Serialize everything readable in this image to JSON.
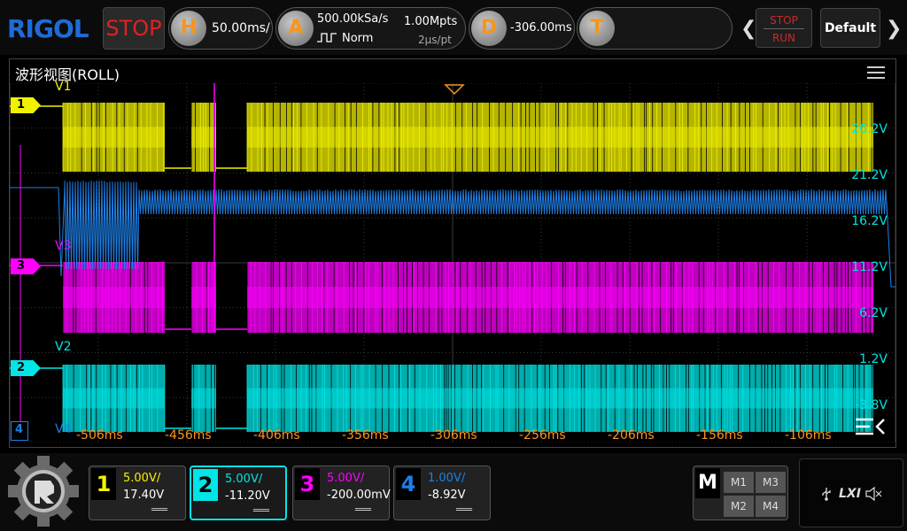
{
  "header": {
    "logo": "RIGOL",
    "stop_label": "STOP",
    "horizontal": {
      "icon": "H",
      "value": "50.00ms/"
    },
    "acquire": {
      "icon": "A",
      "sample_rate": "500.00kSa/s",
      "depth": "1.00Mpts",
      "mode": "Norm",
      "interval": "2μs/pt"
    },
    "delay": {
      "icon": "D",
      "value": "-306.00ms"
    },
    "trigger": {
      "icon": "T"
    },
    "stoprun": {
      "stop": "STOP",
      "run": "RUN"
    },
    "default_label": "Default"
  },
  "window": {
    "title": "波形视图(ROLL)"
  },
  "markers": {
    "ch1_tag": "1",
    "ch2_tag": "2",
    "ch3_tag": "3",
    "ch4_tag": "4",
    "v1": "V1",
    "v2": "V2",
    "v3": "V3",
    "v4": "V4"
  },
  "volt_labels": [
    "26.2V",
    "21.2V",
    "16.2V",
    "11.2V",
    "6.2V",
    "1.2V",
    "-3.8V"
  ],
  "time_labels": [
    "-506ms",
    "-456ms",
    "-406ms",
    "-356ms",
    "-306ms",
    "-256ms",
    "-206ms",
    "-156ms",
    "-106ms"
  ],
  "channels": [
    {
      "num": "1",
      "scale": "5.00V/",
      "offset": "17.40V",
      "color": "#f2f200",
      "selected": false
    },
    {
      "num": "2",
      "scale": "5.00V/",
      "offset": "-11.20V",
      "color": "#00e5e5",
      "selected": true
    },
    {
      "num": "3",
      "scale": "5.00V/",
      "offset": "-200.00mV",
      "color": "#ff00ff",
      "selected": false
    },
    {
      "num": "4",
      "scale": "1.00V/",
      "offset": "-8.92V",
      "color": "#1e7fe6",
      "selected": false
    }
  ],
  "math": {
    "label": "M",
    "m1": "M1",
    "m2": "M2",
    "m3": "M3",
    "m4": "M4"
  },
  "status": {
    "lxi": "LXI"
  },
  "colors": {
    "ch1": "#f2f200",
    "ch2": "#00e5e5",
    "ch3": "#ff00ff",
    "ch4": "#1e7fe6",
    "accent": "#f7951d",
    "grid": "#3a3a3a"
  }
}
